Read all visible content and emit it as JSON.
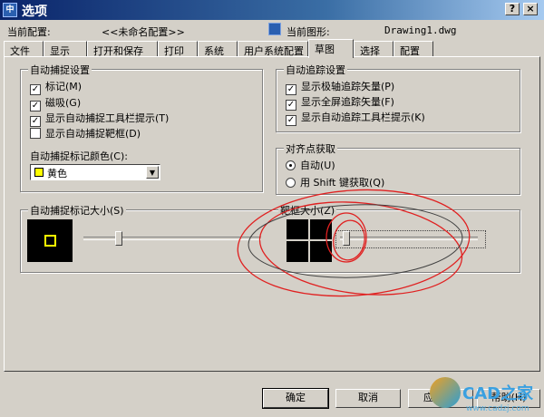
{
  "window": {
    "title": "选项",
    "help_button": "?",
    "close_button": "×"
  },
  "profile": {
    "current_profile_label": "当前配置:",
    "current_profile_value": "<<未命名配置>>",
    "current_drawing_label": "当前图形:",
    "current_drawing_value": "Drawing1.dwg"
  },
  "tabs": [
    {
      "label": "文件"
    },
    {
      "label": "显示"
    },
    {
      "label": "打开和保存"
    },
    {
      "label": "打印"
    },
    {
      "label": "系统"
    },
    {
      "label": "用户系统配置"
    },
    {
      "label": "草图",
      "active": true
    },
    {
      "label": "选择"
    },
    {
      "label": "配置"
    }
  ],
  "autosnap": {
    "title": "自动捕捉设置",
    "options": [
      {
        "label": "标记(M)",
        "checked": true
      },
      {
        "label": "磁吸(G)",
        "checked": true
      },
      {
        "label": "显示自动捕捉工具栏提示(T)",
        "checked": true
      },
      {
        "label": "显示自动捕捉靶框(D)",
        "checked": false
      }
    ],
    "color_label": "自动捕捉标记颜色(C):",
    "color_value": "黄色",
    "color_hex": "#ffff00"
  },
  "autotrack": {
    "title": "自动追踪设置",
    "options": [
      {
        "label": "显示极轴追踪矢量(P)",
        "checked": true
      },
      {
        "label": "显示全屏追踪矢量(F)",
        "checked": true
      },
      {
        "label": "显示自动追踪工具栏提示(K)",
        "checked": true
      }
    ]
  },
  "alignment": {
    "title": "对齐点获取",
    "options": [
      {
        "label": "自动(U)",
        "selected": true
      },
      {
        "label": "用 Shift 键获取(Q)",
        "selected": false
      }
    ]
  },
  "marker_size": {
    "label": "自动捕捉标记大小(S)",
    "value_fraction": 0.2
  },
  "aperture_size": {
    "label": "靶框大小(Z)",
    "value_fraction": 0.02
  },
  "buttons": {
    "ok": "确定",
    "cancel": "取消",
    "apply": "应用(A)",
    "help": "帮助(H)"
  },
  "watermark": {
    "brand": "CAD之家",
    "url": "www.cadzj.com"
  },
  "colors": {
    "title_bar": "#0a246a",
    "dialog_bg": "#d4d0c8",
    "annotation_red": "#e02020"
  }
}
